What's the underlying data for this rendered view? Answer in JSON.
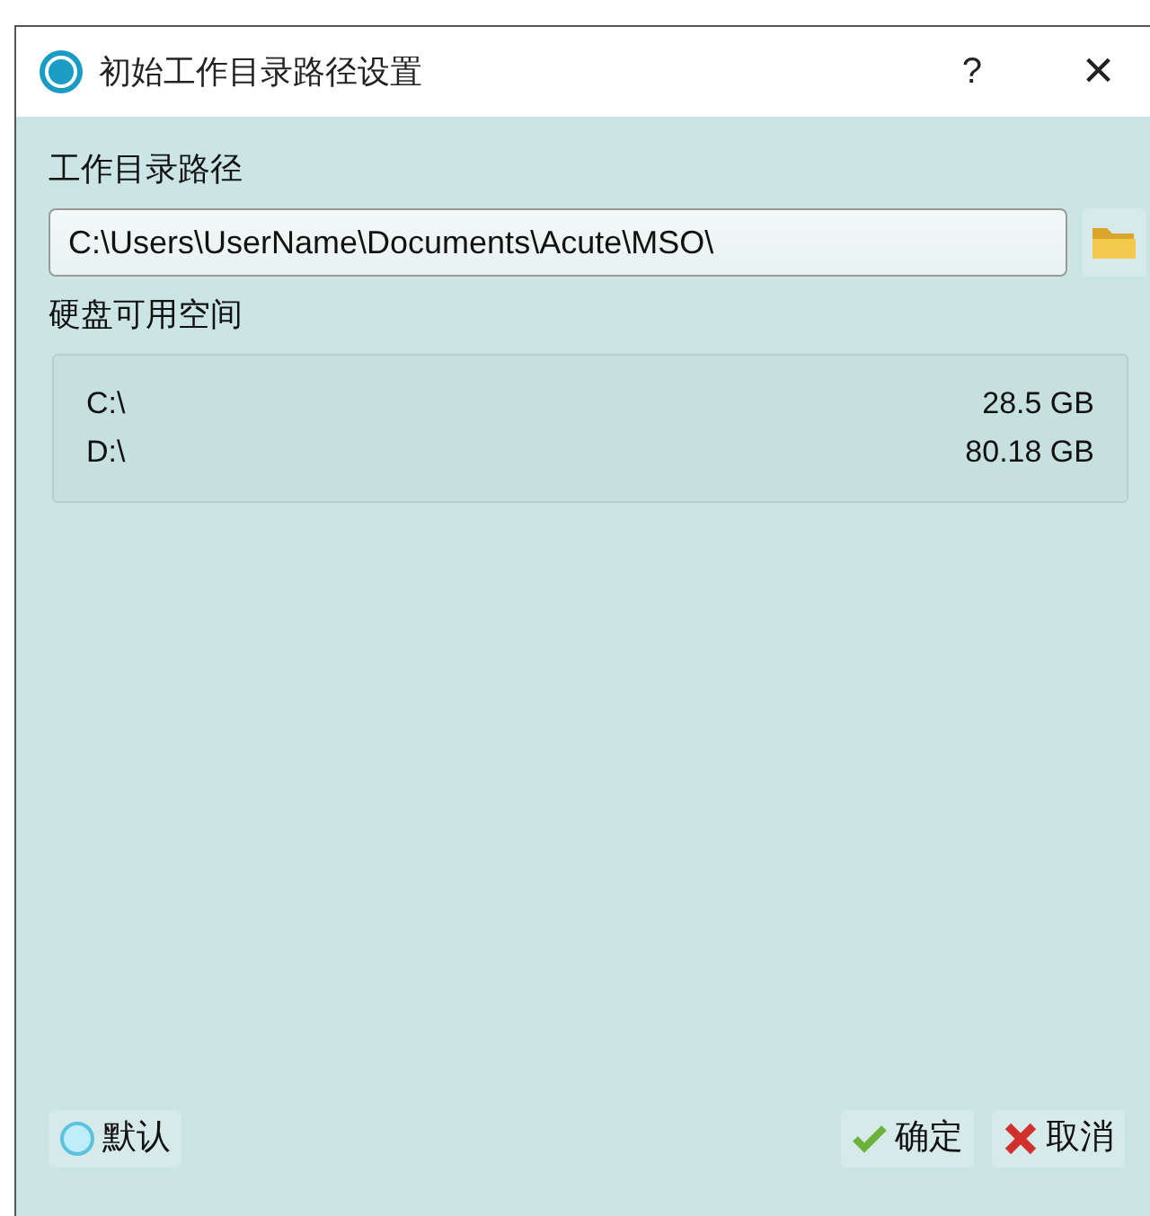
{
  "window": {
    "title": "初始工作目录路径设置",
    "help": "?",
    "close": "×"
  },
  "path_label": "工作目录路径",
  "path_field": {
    "value": "C:\\Users\\UserName\\Documents\\Acute\\MSO\\"
  },
  "disk_label": "硬盘可用空间",
  "disks": [
    {
      "drive": "C:\\",
      "free": "28.5 GB"
    },
    {
      "drive": "D:\\",
      "free": "80.18 GB"
    }
  ],
  "buttons": [
    {
      "kind": "default",
      "label": "默认"
    },
    {
      "kind": "ok",
      "label": "确定"
    },
    {
      "kind": "cancel",
      "label": "取消"
    }
  ]
}
